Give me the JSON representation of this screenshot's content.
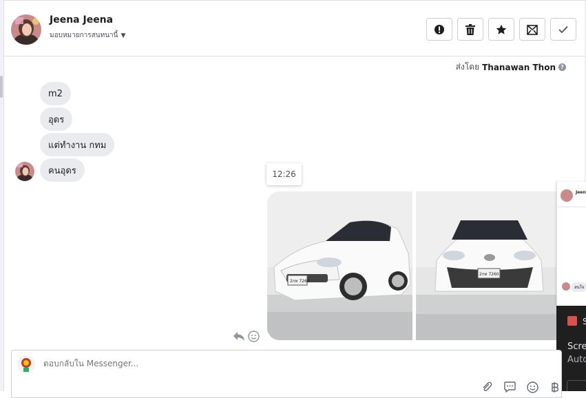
{
  "header": {
    "contact_name": "Jeena Jeena",
    "assign_label": "มอบหมายการสนทนานี้",
    "actions": [
      {
        "name": "report-button",
        "icon": "alert-icon"
      },
      {
        "name": "delete-button",
        "icon": "trash-icon"
      },
      {
        "name": "star-button",
        "icon": "star-icon"
      },
      {
        "name": "mark-unread-button",
        "icon": "envelope-icon"
      },
      {
        "name": "done-button",
        "icon": "check-icon"
      }
    ]
  },
  "conversation": {
    "sent_by_prefix": "ส่งโดย",
    "sent_by_name": "Thanawan Thon",
    "messages": [
      {
        "text": "m2"
      },
      {
        "text": "อุดร"
      },
      {
        "text": "แต่ทำงาน กทม"
      },
      {
        "text": "คนอุดร"
      }
    ],
    "timestamp": "12:26",
    "photos": [
      {
        "alt": "white hatchback car front-side view",
        "plate": "2กท 7260"
      },
      {
        "alt": "white hatchback car front view",
        "plate": "2กท 7260"
      }
    ]
  },
  "side_panel": {
    "name_fragment": "Jeen",
    "chip_fragment": "สนใจ",
    "dark_title_fragment": "S",
    "dark_line1": "Scre",
    "dark_line2": "Auto"
  },
  "composer": {
    "placeholder": "ตอบกลับใน Messenger..."
  },
  "colors": {
    "bubble_bg": "#e9ebee",
    "border": "#dddfe2",
    "text": "#1c1e21"
  }
}
